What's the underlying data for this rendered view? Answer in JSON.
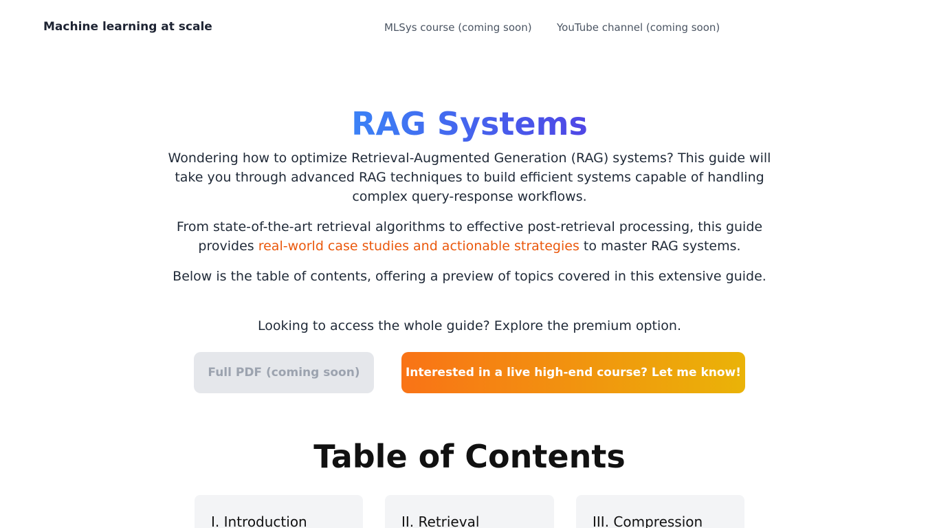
{
  "header": {
    "brand": "Machine learning at scale",
    "nav": [
      {
        "label": "MLSys course (coming soon)"
      },
      {
        "label": "YouTube channel (coming soon)"
      }
    ]
  },
  "hero": {
    "title": "RAG Systems",
    "intro": "Wondering how to optimize Retrieval-Augmented Generation (RAG) systems? This guide will take you through advanced RAG techniques to build efficient systems capable of handling complex query-response workflows.",
    "p2_before": "From state-of-the-art retrieval algorithms to effective post-retrieval processing, this guide provides ",
    "p2_highlight": "real-world case studies and actionable strategies",
    "p2_after": " to master RAG systems.",
    "toc_note": "Below is the table of contents, offering a preview of topics covered in this extensive guide.",
    "premium_note": "Looking to access the whole guide? Explore the premium option.",
    "highlight_color": "#ea580c"
  },
  "buttons": {
    "pdf_label": "Full PDF (coming soon)",
    "course_label": "Interested in a live high-end course? Let me know!"
  },
  "toc": {
    "title": "Table of Contents",
    "cards": [
      {
        "title": "I. Introduction"
      },
      {
        "title": "II. Retrieval"
      },
      {
        "title": "III. Compression"
      }
    ]
  }
}
